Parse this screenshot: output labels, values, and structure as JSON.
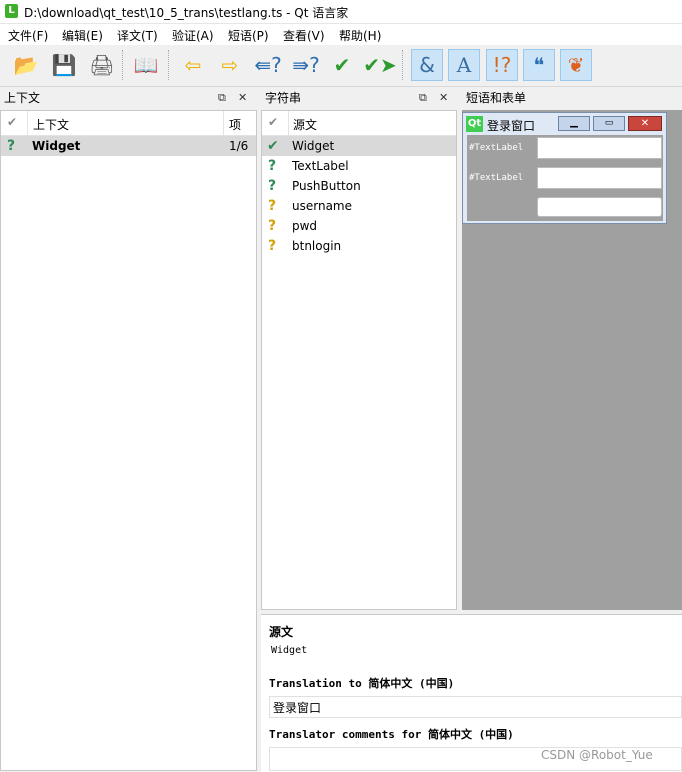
{
  "window": {
    "title": "D:\\download\\qt_test\\10_5_trans\\testlang.ts - Qt 语言家",
    "app_icon_letter": "L"
  },
  "menu": [
    "文件(F)",
    "编辑(E)",
    "译文(T)",
    "验证(A)",
    "短语(P)",
    "查看(V)",
    "帮助(H)"
  ],
  "toolbar": {
    "icons": [
      "open-icon",
      "save-icon",
      "print-icon",
      "phrasebook-icon",
      "prev-icon",
      "next-icon",
      "prev-unfinished-icon",
      "next-unfinished-icon",
      "done-icon",
      "done-next-icon",
      "accelerator-check-icon",
      "punctuation-check-icon",
      "phrase-check-icon",
      "placemarker-check-icon",
      "surrounding-whitespace-icon"
    ]
  },
  "context_dock": {
    "title": "上下文",
    "columns": {
      "source": "上下文",
      "items": "项"
    },
    "rows": [
      {
        "name": "Widget",
        "count": "1/6"
      }
    ]
  },
  "strings_dock": {
    "title": "字符串",
    "column": "源文",
    "rows": [
      {
        "text": "Widget",
        "status": "done"
      },
      {
        "text": "TextLabel",
        "status": "unfinished"
      },
      {
        "text": "PushButton",
        "status": "unfinished"
      },
      {
        "text": "username",
        "status": "obsolete"
      },
      {
        "text": "pwd",
        "status": "obsolete"
      },
      {
        "text": "btnlogin",
        "status": "obsolete"
      }
    ]
  },
  "phrases_dock": {
    "title": "短语和表单"
  },
  "form_preview": {
    "window_title": "登录窗口",
    "label1": "#TextLabel",
    "label2": "#TextLabel"
  },
  "editor": {
    "source_heading": "源文",
    "source_text": "Widget",
    "translation_heading": "Translation to 简体中文 (中国)",
    "translation_value": "登录窗口",
    "comments_heading": "Translator comments for 简体中文 (中国)"
  },
  "watermark": "CSDN @Robot_Yue",
  "colors": {
    "done": "#2e8b57",
    "unfinished": "#2e8b57",
    "obsolete": "#d4a10a",
    "selection": "#d9d9d9",
    "toolbar_highlight": "#cce4f7"
  }
}
